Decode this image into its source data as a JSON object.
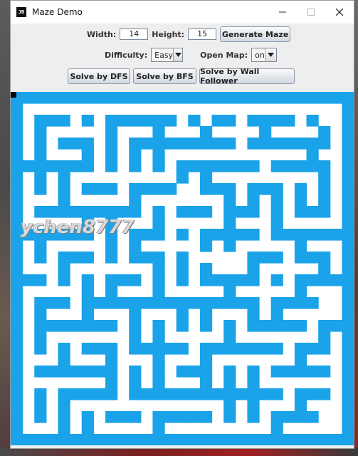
{
  "window": {
    "title": "Maze Demo",
    "app_icon_text": "JB"
  },
  "controls": {
    "width_label": "Width:",
    "width_value": "14",
    "height_label": "Height:",
    "height_value": "15",
    "generate_label": "Generate Maze",
    "difficulty_label": "Difficulty:",
    "difficulty_value": "Easy",
    "openmap_label": "Open Map:",
    "openmap_value": "on",
    "solve_dfs_label": "Solve by DFS",
    "solve_bfs_label": "Solve by BFS",
    "solve_wall_label": "Solve by Wall Follower"
  },
  "maze": {
    "wall_color": "#1aa3e8",
    "path_color": "#ffffff",
    "start_color": "#000000",
    "cols": 29,
    "rows": 31,
    "grid": [
      "11111111111111111111111111111",
      "10000000000000000000000000001",
      "10111010111111010110111101001",
      "10100000100010001000010000101",
      "10101110101111111110111111101",
      "10100010101010000000000001001",
      "11111110101010111111101111101",
      "10101000000000101000000000101",
      "10101011101111001110111010101",
      "10001000001000000010101010101",
      "10111111111010111011101011101",
      "10000010100010000010001000001",
      "11111110101110101111101111111",
      "10100000101000001010000010001",
      "10101110101110100000111011101",
      "10001000000010101000100000101",
      "11101010111010101111101011111",
      "10000010100010000010000010001",
      "10111011111111111111101111001",
      "10100010001000101000101000001",
      "10111111101010101010111110111",
      "10100000001010000010000000101",
      "10101011101111101111111011101",
      "10001000100010001000000010001",
      "10111111101010111010101111101",
      "10000000101010001010100000001",
      "10101111101111111111111011101",
      "10101000000000000010100010001",
      "10101010111011111010101111001",
      "10001010000010000000001000001",
      "11111111111111111111111111111"
    ]
  },
  "watermark": "ychen8777"
}
